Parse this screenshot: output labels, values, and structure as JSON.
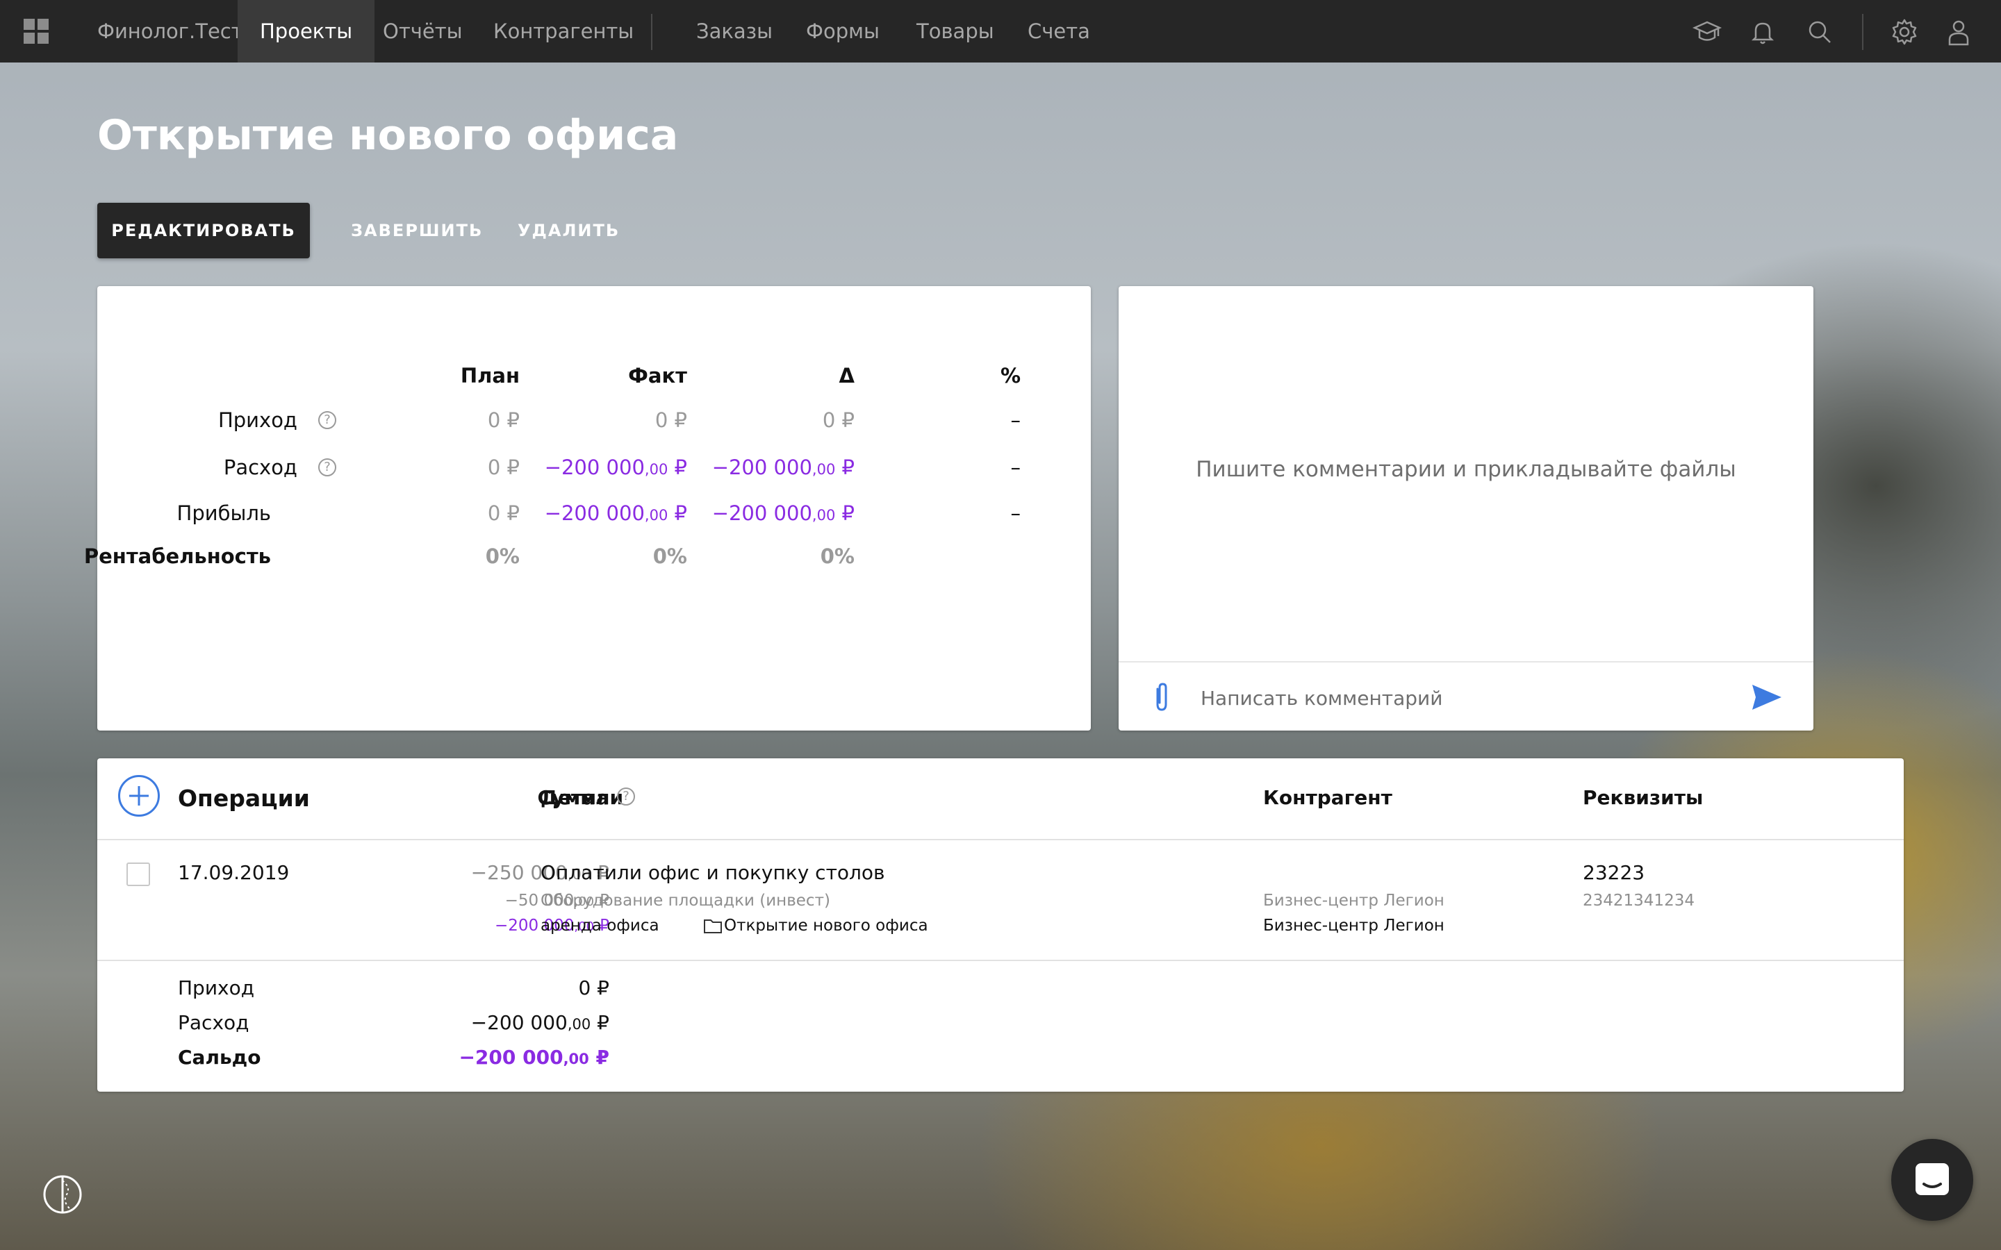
{
  "nav": {
    "brand": "Финолог.Тест",
    "items": [
      {
        "label": "Проекты",
        "active": true
      },
      {
        "label": "Отчёты"
      },
      {
        "label": "Контрагенты"
      }
    ],
    "items2": [
      {
        "label": "Заказы"
      },
      {
        "label": "Формы"
      },
      {
        "label": "Товары"
      },
      {
        "label": "Счета"
      }
    ],
    "right_icons": [
      "graduation-cap-icon",
      "bell-icon",
      "search-icon",
      "gear-icon",
      "user-icon"
    ]
  },
  "page": {
    "title": "Открытие нового офиса",
    "actions": {
      "edit": "РЕДАКТИРОВАТЬ",
      "finish": "ЗАВЕРШИТЬ",
      "delete": "УДАЛИТЬ"
    }
  },
  "summary": {
    "headers": {
      "plan": "План",
      "fact": "Факт",
      "delta": "Δ",
      "percent": "%"
    },
    "rows": [
      {
        "label": "Приход",
        "help": "?",
        "plan": "0 ₽",
        "fact": {
          "main": "0 ₽"
        },
        "delta": {
          "main": "0 ₽"
        },
        "percent": "–"
      },
      {
        "label": "Расход",
        "help": "?",
        "plan": "0 ₽",
        "fact": {
          "main": "−200 000",
          "cents": ",00",
          "cur": " ₽"
        },
        "delta": {
          "main": "−200 000",
          "cents": ",00",
          "cur": " ₽"
        },
        "percent": "–"
      },
      {
        "label": "Прибыль",
        "plan": "0 ₽",
        "fact": {
          "main": "−200 000",
          "cents": ",00",
          "cur": " ₽"
        },
        "delta": {
          "main": "−200 000",
          "cents": ",00",
          "cur": " ₽"
        },
        "percent": "–"
      },
      {
        "label": "Рентабельность",
        "plan": "0%",
        "fact": {
          "main": "0%"
        },
        "delta": {
          "main": "0%"
        }
      }
    ]
  },
  "comments": {
    "hint": "Пишите комментарии и прикладывайте файлы",
    "placeholder": "Написать комментарий"
  },
  "operations": {
    "title": "Операции",
    "columns": {
      "sum": "Сумма",
      "details": "Детали",
      "help": "?",
      "counterparty": "Контрагент",
      "requisites": "Реквизиты"
    },
    "rows": [
      {
        "date": "17.09.2019",
        "sum1": {
          "main": "−250 000",
          "cents": ",00",
          "cur": " ₽"
        },
        "sum2": {
          "main": "−50 000",
          "cents": ",00",
          "cur": " ₽"
        },
        "sum3": {
          "main": "−200 000",
          "cents": ",00",
          "cur": " ₽"
        },
        "details_title": "Оплатили офис и покупку столов",
        "details_category": "Оборудование площадки (инвест)",
        "details_tag": "аренда офиса",
        "details_project": "Открытие нового офиса",
        "counterparty1": "Бизнес-центр Легион",
        "counterparty2": "Бизнес-центр Легион",
        "requisite": "23223",
        "requisite_account": "23421341234"
      }
    ],
    "totals": {
      "income_label": "Приход",
      "income": "0 ₽",
      "expense_label": "Расход",
      "expense": {
        "main": "−200 000",
        "cents": ",00",
        "cur": " ₽"
      },
      "balance_label": "Сальдо",
      "balance": {
        "main": "−200 000",
        "cents": ",00",
        "cur": " ₽"
      }
    }
  },
  "colors": {
    "accent_purple": "#8a2be2",
    "accent_blue": "#3d7be0",
    "topbar": "#262626"
  }
}
